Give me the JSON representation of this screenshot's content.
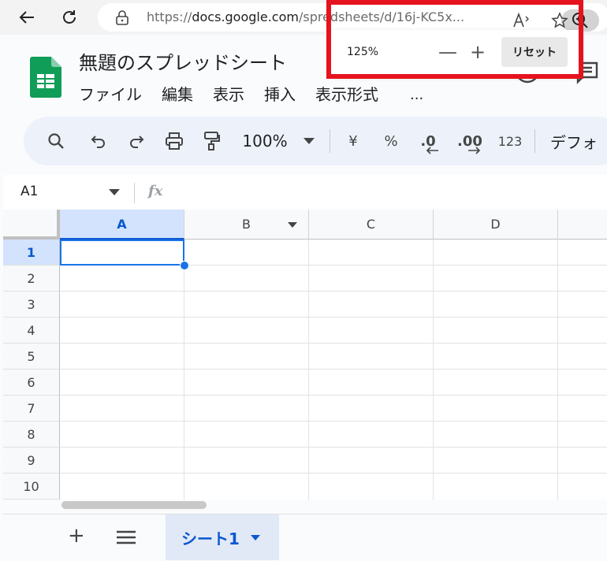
{
  "browser": {
    "url_dim": "https://",
    "url_host": "docs.google.com",
    "url_path": "/spre",
    "url_tail": "dsheets/d/16j-KC5x...",
    "icons": [
      "back-arrow-icon",
      "refresh-icon",
      "lock-icon",
      "zoom-in-icon",
      "read-aloud-icon",
      "favorite-star-icon"
    ]
  },
  "zoom_popup": {
    "level": "125%",
    "zoom_out": "—",
    "zoom_in": "+",
    "reset_label": "リセット"
  },
  "app": {
    "title": "無題のスプレッドシート",
    "menu": [
      "ファイル",
      "編集",
      "表示",
      "挿入",
      "表示形式"
    ],
    "menu_more": "..."
  },
  "toolbar": {
    "zoom_value": "100%",
    "currency": "¥",
    "percent": "%",
    "dec_minus": ".0",
    "dec_plus": ".00",
    "num_format": "123",
    "font": "デフォ"
  },
  "formula_bar": {
    "name_box": "A1",
    "fx": "fx"
  },
  "grid": {
    "columns": [
      "A",
      "B",
      "C",
      "D"
    ],
    "rows": [
      "1",
      "2",
      "3",
      "4",
      "5",
      "6",
      "7",
      "8",
      "9",
      "10"
    ],
    "selected_cell": "A1"
  },
  "sheets": {
    "add_label": "+",
    "tab_label": "シート1"
  },
  "colors": {
    "highlight": "#e5131e",
    "accent": "#0b57d0",
    "sheets_green": "#0f9d58"
  }
}
